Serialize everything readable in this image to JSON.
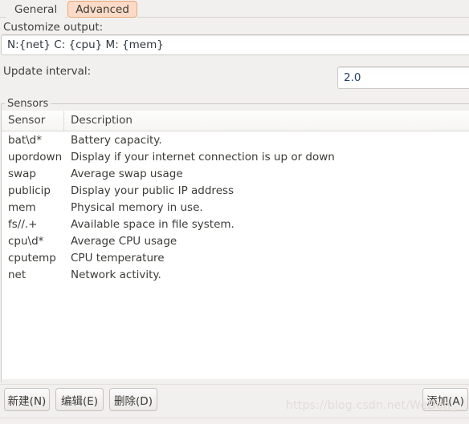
{
  "tabs": [
    {
      "label": "General",
      "active": false
    },
    {
      "label": "Advanced",
      "active": true
    }
  ],
  "form": {
    "customize_label": "Customize output:",
    "customize_value": "N:{net} C: {cpu} M: {mem}",
    "customize_placeholder": "",
    "interval_label": "Update interval:",
    "interval_value": "2.0",
    "interval_placeholder": ""
  },
  "sensors_group": {
    "legend": "Sensors",
    "columns": [
      "Sensor",
      "Description"
    ],
    "rows": [
      {
        "sensor": "bat\\d*",
        "description": "Battery capacity."
      },
      {
        "sensor": "upordown",
        "description": "Display if your internet connection is up or down"
      },
      {
        "sensor": "swap",
        "description": "Average swap usage"
      },
      {
        "sensor": "publicip",
        "description": "Display your public IP address"
      },
      {
        "sensor": "mem",
        "description": "Physical memory in use."
      },
      {
        "sensor": "fs//.+",
        "description": "Available space in file system."
      },
      {
        "sensor": "cpu\\d*",
        "description": "Average CPU usage"
      },
      {
        "sensor": "cputemp",
        "description": "CPU temperature"
      },
      {
        "sensor": "net",
        "description": "Network activity."
      }
    ]
  },
  "actions": {
    "new_label": "新建(N)",
    "edit_label": "编辑(E)",
    "delete_label": "删除(D)",
    "add_label": "添加(A)"
  },
  "watermark": {
    "text": "https://blog.csdn.net/WeDon_"
  },
  "colors": {
    "window_bg": "#f2f0ee",
    "active_tab_bg": "#fbdbc7",
    "active_tab_border": "#e8a878",
    "list_bg": "#ffffff",
    "text": "#3c3b37",
    "entry_value": "#253d66"
  }
}
